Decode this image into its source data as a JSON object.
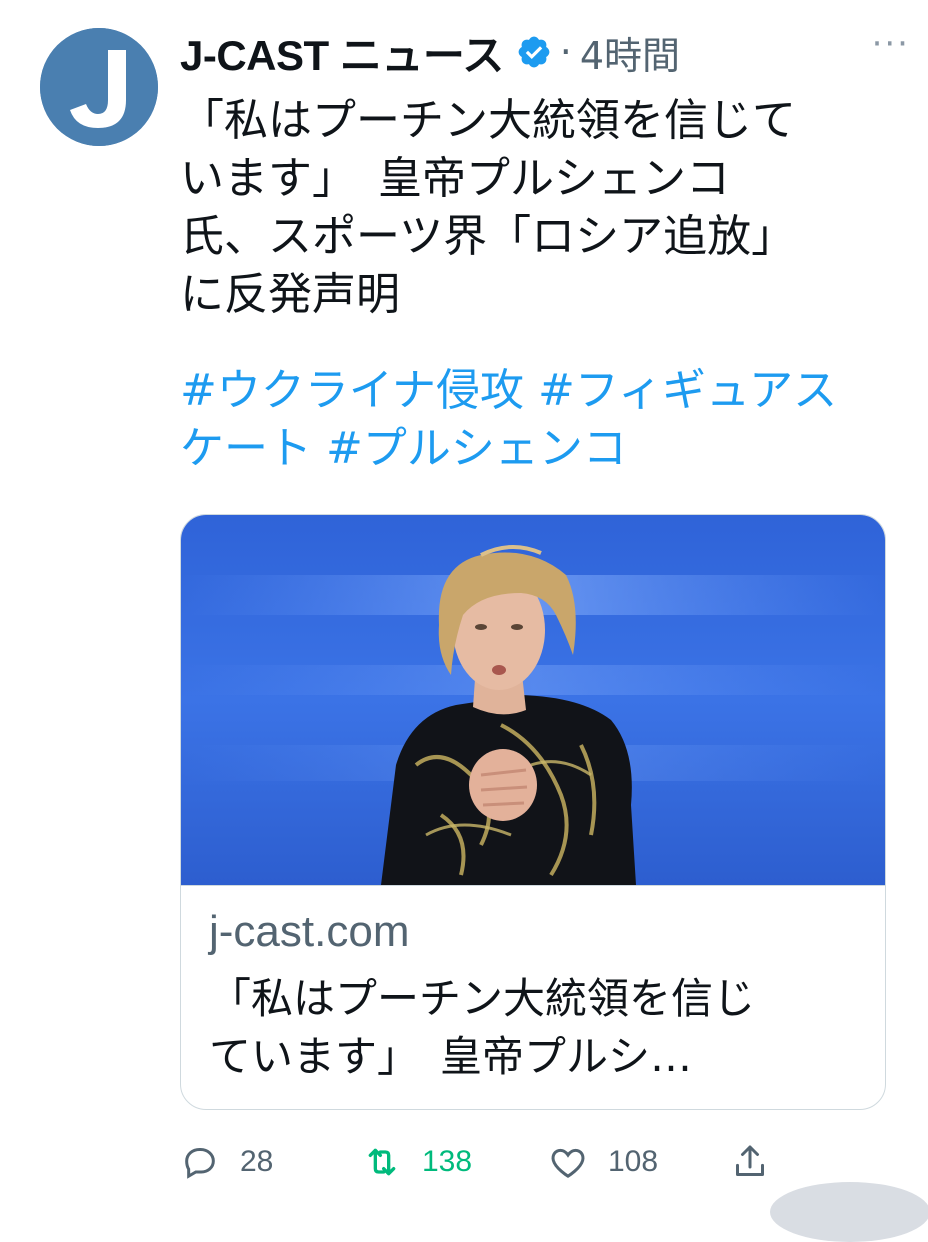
{
  "tweet": {
    "author_name": "J-CAST ニュース",
    "time_sep": "·",
    "time": "4時間",
    "more": "···",
    "avatar_letter": "J",
    "body": "「私はプーチン大統領を信じて\nいます」　皇帝プルシェンコ\n氏、スポーツ界「ロシア追放」\nに反発声明",
    "hashtags": [
      "#ウクライナ侵攻",
      "#フィギュアス\nケート",
      "#プルシェンコ"
    ]
  },
  "card": {
    "domain": "j-cast.com",
    "title": "「私はプーチン大統領を信じ\nています」　皇帝プルシ…"
  },
  "actions": {
    "replies": "28",
    "retweets": "138",
    "likes": "108"
  },
  "colors": {
    "link": "#1d9bf0",
    "retweet": "#00ba7c",
    "avatar_bg": "#4a7fb0",
    "muted": "#536471"
  },
  "icons": [
    "reply-icon",
    "retweet-icon",
    "like-icon",
    "share-icon",
    "verified-icon",
    "more-icon"
  ]
}
